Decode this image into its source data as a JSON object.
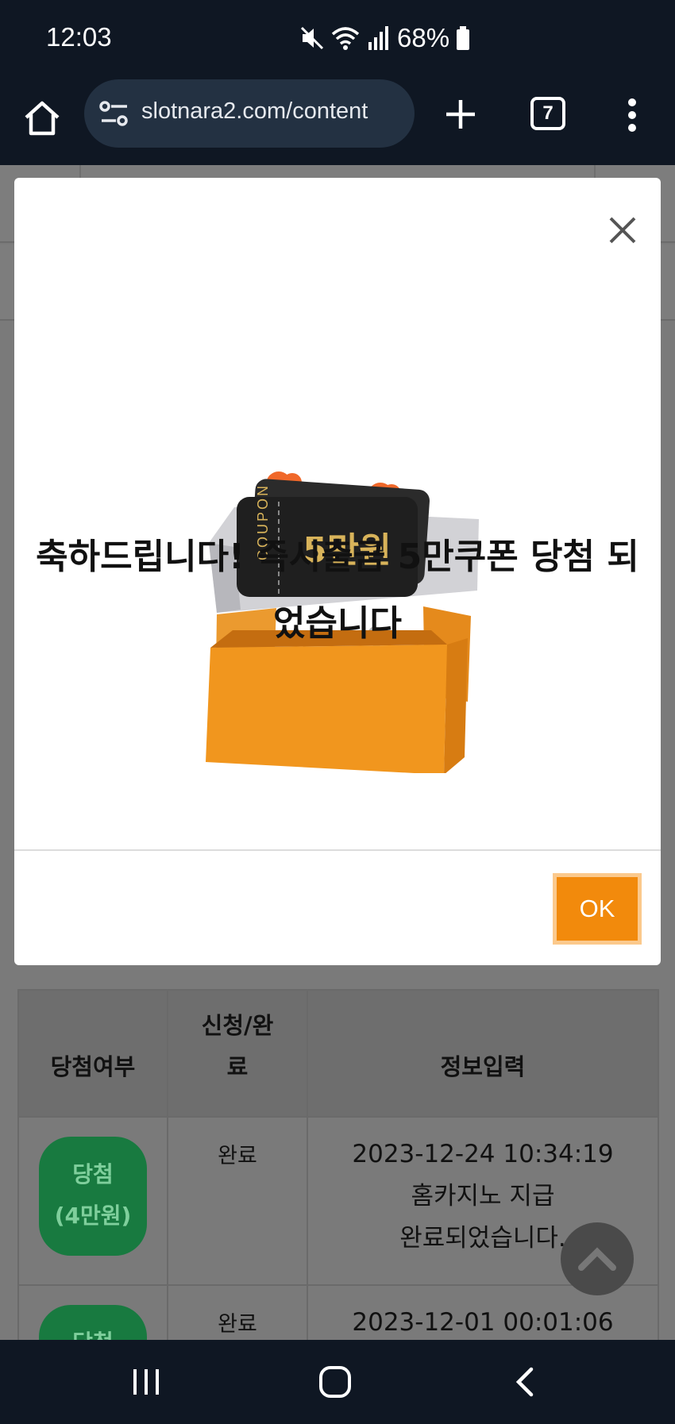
{
  "status_bar": {
    "time": "12:03",
    "battery": "68%"
  },
  "browser": {
    "url": "slotnara2.com/content",
    "tab_count": "7"
  },
  "modal": {
    "coupon_label": "COUPON",
    "coupon_amount": "5만원",
    "message": "축하드립니다! 즉시출금 5만쿠폰 당첨 되었습니다",
    "ok_label": "OK"
  },
  "table": {
    "headers": [
      "당첨여부",
      "신청/완료",
      "정보입력"
    ],
    "rows": [
      {
        "result": "당첨 (4만원)",
        "status": "완료",
        "info_line1": "2023-12-24 10:34:19",
        "info_line2": "홈카지노 지급",
        "info_line3": "완료되었습니다."
      },
      {
        "result": "당첨",
        "status": "완료",
        "info_line1": "2023-12-01 00:01:06"
      }
    ]
  },
  "colors": {
    "accent": "#f28a0c",
    "win_badge": "#187a40",
    "system_bar": "#0f1723"
  }
}
